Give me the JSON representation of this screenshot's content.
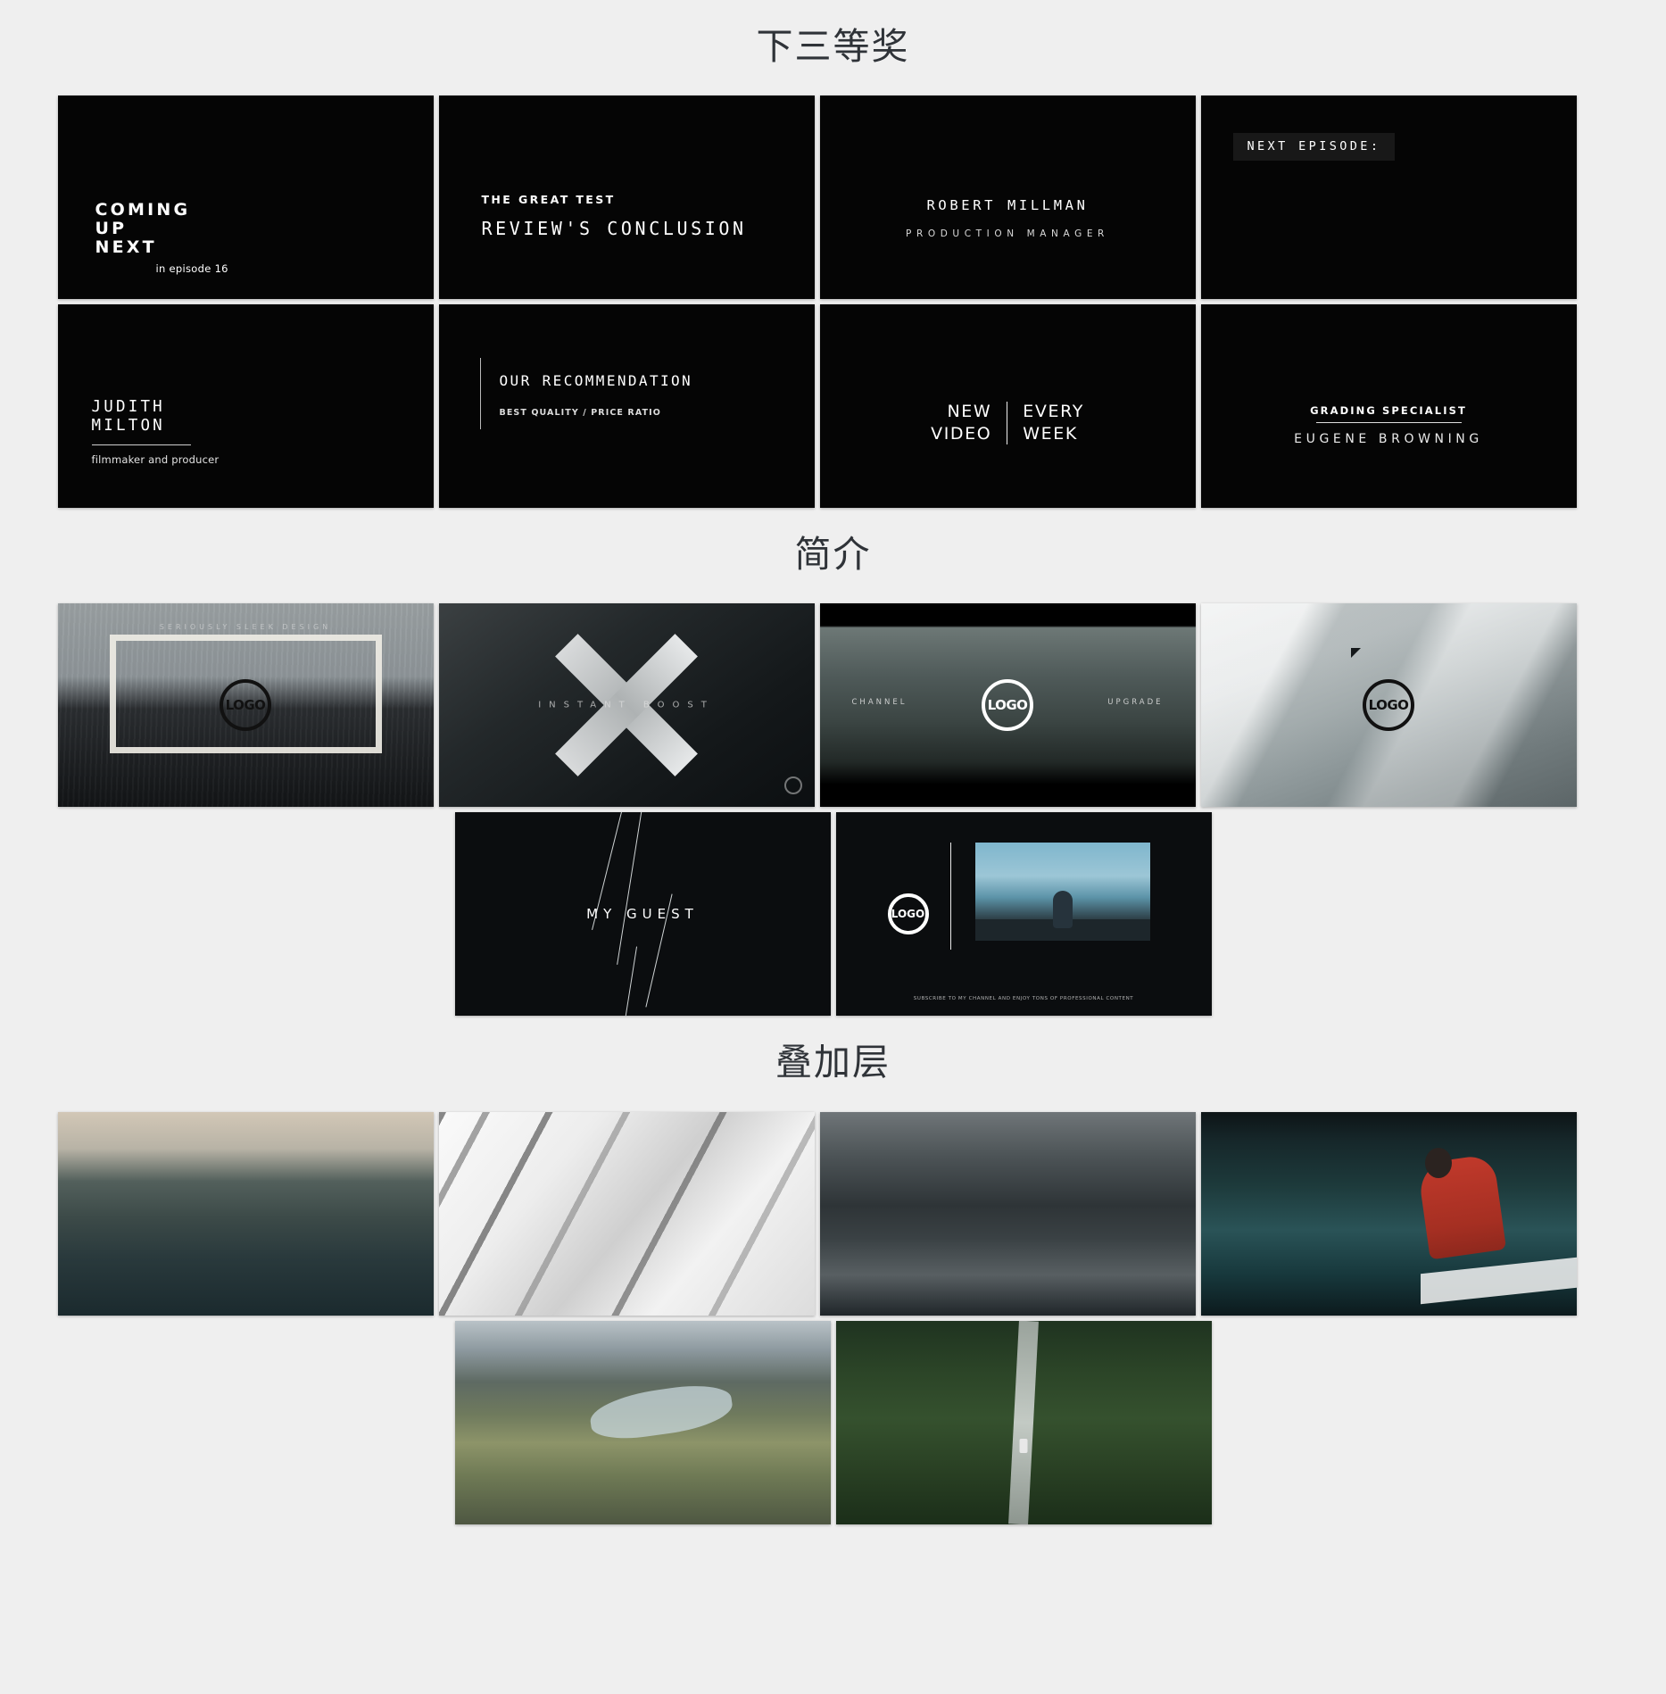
{
  "sections": [
    {
      "title": "下三等奖",
      "cards": [
        {
          "name": "coming-up-next",
          "lines": [
            "COMING",
            "UP",
            "NEXT"
          ],
          "sub": "in episode 16"
        },
        {
          "name": "great-test",
          "kicker": "THE GREAT TEST",
          "title": "REVIEW'S CONCLUSION"
        },
        {
          "name": "robert-millman",
          "person": "ROBERT MILLMAN",
          "role": "PRODUCTION MANAGER"
        },
        {
          "name": "next-episode",
          "badge": "NEXT EPISODE:"
        },
        {
          "name": "judith-milton",
          "lines": [
            "JUDITH",
            "MILTON"
          ],
          "role": "filmmaker and producer"
        },
        {
          "name": "our-recommendation",
          "title": "OUR RECOMMENDATION",
          "sub": "BEST QUALITY / PRICE RATIO"
        },
        {
          "name": "new-video-every-week",
          "left": [
            "NEW",
            "VIDEO"
          ],
          "right": [
            "EVERY",
            "WEEK"
          ]
        },
        {
          "name": "grading-specialist",
          "kicker": "GRADING SPECIALIST",
          "person": "EUGENE BROWNING"
        }
      ]
    },
    {
      "title": "简介",
      "cards": [
        {
          "name": "windmill-logo-frame",
          "overlay_text": "SERIOUSLY SLEEK DESIGN",
          "logo": "LOGO"
        },
        {
          "name": "instant-boost-x",
          "overlay_text": "INSTANT BOOST"
        },
        {
          "name": "mountain-channel-upgrade",
          "left_label": "CHANNEL",
          "right_label": "UPGRADE",
          "logo": "LOGO"
        },
        {
          "name": "glacier-logo",
          "logo": "LOGO"
        },
        {
          "name": "my-guest",
          "overlay_text": "MY GUEST"
        },
        {
          "name": "subscribe-promo",
          "logo": "LOGO",
          "caption": "SUBSCRIBE TO MY CHANNEL AND ENJOY TONS OF PROFESSIONAL CONTENT"
        }
      ]
    },
    {
      "title": "叠加层",
      "cards": [
        {
          "name": "cliffs-of-moher"
        },
        {
          "name": "marble-texture"
        },
        {
          "name": "dark-cave-beach"
        },
        {
          "name": "boat-woman-red-jacket"
        },
        {
          "name": "valley-river-aerial"
        },
        {
          "name": "forest-road-aerial"
        }
      ]
    }
  ]
}
